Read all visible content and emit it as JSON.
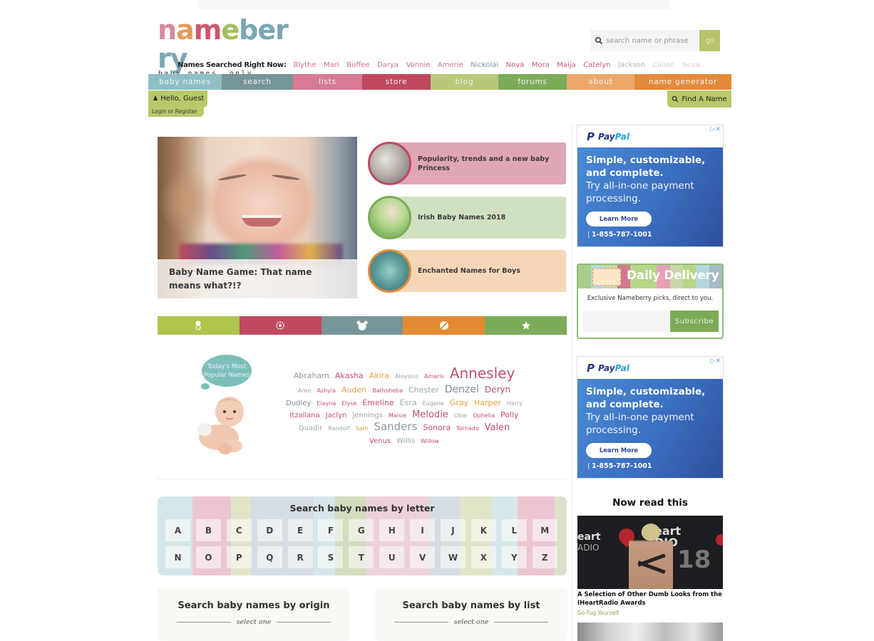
{
  "header": {
    "logo": {
      "letters": [
        "n",
        "a",
        "m",
        "e",
        "b",
        "e",
        "r",
        "r",
        "y"
      ],
      "letter_colors": [
        "#d98aa0",
        "#e39a5a",
        "#d0576e",
        "#9fc05c",
        "#7aa7b4",
        "#7aa7b4",
        "#7aa7b4",
        "#7aa7b4",
        "#7aa7b4"
      ],
      "tagline": "baby names, only cooler"
    },
    "search": {
      "placeholder": "search name or phrase",
      "go_label": "go"
    },
    "searched_now": {
      "label": "Names Searched Right Now:",
      "names": [
        {
          "name": "Blythe",
          "color": "#d0708c"
        },
        {
          "name": "Mari",
          "color": "#d0708c"
        },
        {
          "name": "Buffee",
          "color": "#d0708c"
        },
        {
          "name": "Darya",
          "color": "#d0708c"
        },
        {
          "name": "Vonnie",
          "color": "#d0708c"
        },
        {
          "name": "Amerie",
          "color": "#d0708c"
        },
        {
          "name": "Nickolai",
          "color": "#7a9aa2"
        },
        {
          "name": "Nova",
          "color": "#c85a78"
        },
        {
          "name": "Mora",
          "color": "#c85a78"
        },
        {
          "name": "Maija",
          "color": "#c85a78"
        },
        {
          "name": "Catelyn",
          "color": "#c85a78"
        },
        {
          "name": "Jackson",
          "color": "#a9b8bc"
        },
        {
          "name": "Cillian",
          "color": "#c6d2d6"
        },
        {
          "name": "Nova",
          "color": "#efc8d4"
        }
      ]
    }
  },
  "nav": {
    "items": [
      {
        "label": "baby names",
        "color": "#8fbfc5",
        "width": 103
      },
      {
        "label": "search",
        "color": "#779599",
        "width": 100
      },
      {
        "label": "lists",
        "color": "#d87a94",
        "width": 97
      },
      {
        "label": "store",
        "color": "#c04860",
        "width": 96
      },
      {
        "label": "blog",
        "color": "#b8c878",
        "width": 95
      },
      {
        "label": "forums",
        "color": "#7cab5a",
        "width": 96
      },
      {
        "label": "about",
        "color": "#eca868",
        "width": 95
      },
      {
        "label": "name generator",
        "color": "#e48a3a",
        "width": 136
      }
    ],
    "hello": "Hello, Guest",
    "login": "Login or Register",
    "find": "Find A Name"
  },
  "feature": {
    "caption": "Baby Name Game: That name means what?!?"
  },
  "feature_list": [
    {
      "text": "Popularity, trends and a new baby Princess",
      "bg": "#e0a6b4",
      "ring": "#c04860"
    },
    {
      "text": "Irish Baby Names 2018",
      "bg": "#cfe1c0",
      "ring": "#7cab5a"
    },
    {
      "text": "Enchanted Names for Boys",
      "bg": "#f5d7b8",
      "ring": "#e48a3a"
    }
  ],
  "category_bar": [
    {
      "icon": "pacifier-icon",
      "color": "#b0c44e"
    },
    {
      "icon": "flower-icon",
      "color": "#c04860"
    },
    {
      "icon": "bear-icon",
      "color": "#779599"
    },
    {
      "icon": "ball-icon",
      "color": "#e48a32"
    },
    {
      "icon": "star-icon",
      "color": "#7cab5a"
    }
  ],
  "popular": {
    "bubble": "Today's Most Popular Names",
    "lines": [
      [
        {
          "name": "Abraham",
          "size": 11,
          "color": "#8a9aa0"
        },
        {
          "name": "Akasha",
          "size": 11,
          "color": "#c8506e"
        },
        {
          "name": "Akira",
          "size": 11,
          "color": "#e8a040"
        },
        {
          "name": "Aloysius",
          "size": 8,
          "color": "#98a8ac"
        },
        {
          "name": "Amaris",
          "size": 8,
          "color": "#c8506e"
        },
        {
          "name": "Annesley",
          "size": 20,
          "color": "#c0506c"
        }
      ],
      [
        {
          "name": "Aren",
          "size": 8,
          "color": "#98a8ac"
        },
        {
          "name": "Ashyla",
          "size": 8,
          "color": "#c8506e"
        },
        {
          "name": "Auden",
          "size": 11,
          "color": "#e8a040"
        },
        {
          "name": "Bathsheba",
          "size": 8,
          "color": "#c8506e"
        },
        {
          "name": "Chester",
          "size": 11,
          "color": "#98a8ac"
        },
        {
          "name": "Denzel",
          "size": 14,
          "color": "#7a8e94"
        },
        {
          "name": "Deryn",
          "size": 12,
          "color": "#c0506c"
        }
      ],
      [
        {
          "name": "Dudley",
          "size": 10,
          "color": "#7a8e94"
        },
        {
          "name": "Elayna",
          "size": 8,
          "color": "#c8506e"
        },
        {
          "name": "Elyse",
          "size": 8,
          "color": "#c8506e"
        },
        {
          "name": "Emeline",
          "size": 11,
          "color": "#c8506e"
        },
        {
          "name": "Esra",
          "size": 11,
          "color": "#98a8ac"
        },
        {
          "name": "Eugene",
          "size": 8,
          "color": "#98a8ac"
        },
        {
          "name": "Gray",
          "size": 11,
          "color": "#e8a040"
        },
        {
          "name": "Harper",
          "size": 11,
          "color": "#e8a040"
        },
        {
          "name": "Harry",
          "size": 8,
          "color": "#98a8ac"
        }
      ],
      [
        {
          "name": "Itzallana",
          "size": 10,
          "color": "#c8506e"
        },
        {
          "name": "Jaclyn",
          "size": 10,
          "color": "#c8506e"
        },
        {
          "name": "Jennings",
          "size": 10,
          "color": "#98a8ac"
        },
        {
          "name": "Maisie",
          "size": 8,
          "color": "#c8506e"
        },
        {
          "name": "Melodie",
          "size": 13,
          "color": "#c0506c"
        },
        {
          "name": "Obie",
          "size": 8,
          "color": "#98a8ac"
        },
        {
          "name": "Ophelia",
          "size": 8,
          "color": "#c8506e"
        },
        {
          "name": "Polly",
          "size": 11,
          "color": "#c8506e"
        }
      ],
      [
        {
          "name": "Quadir",
          "size": 10,
          "color": "#98a8ac"
        },
        {
          "name": "Randolf",
          "size": 8,
          "color": "#98a8ac"
        },
        {
          "name": "Sam",
          "size": 8,
          "color": "#e8a040"
        },
        {
          "name": "Sanders",
          "size": 15,
          "color": "#8a9aa0"
        },
        {
          "name": "Sonora",
          "size": 11,
          "color": "#c8506e"
        },
        {
          "name": "Tornado",
          "size": 8,
          "color": "#c8506e"
        },
        {
          "name": "Valen",
          "size": 13,
          "color": "#c0506c"
        }
      ],
      [
        {
          "name": "Venus",
          "size": 10,
          "color": "#c8506e"
        },
        {
          "name": "Willis",
          "size": 10,
          "color": "#98a8ac"
        },
        {
          "name": "Willow",
          "size": 8,
          "color": "#c8506e"
        }
      ]
    ]
  },
  "letters": {
    "title": "Search baby names by letter",
    "items": [
      "A",
      "B",
      "C",
      "D",
      "E",
      "F",
      "G",
      "H",
      "I",
      "J",
      "K",
      "L",
      "M",
      "N",
      "O",
      "P",
      "Q",
      "R",
      "S",
      "T",
      "U",
      "V",
      "W",
      "X",
      "Y",
      "Z"
    ],
    "stripe_colors": [
      "#d6e7ea",
      "#ebc6d0",
      "#dfe6c6",
      "#d6dde2",
      "#d6dde2",
      "#d6e7ea",
      "#d3dcbd",
      "#ecd1dc",
      "#ecd1dc",
      "#d6dde2",
      "#dfe6c6",
      "#d6e7ea",
      "#ebc6d0",
      "#d9e2c8"
    ]
  },
  "search_cards": [
    {
      "title": "Search baby names by origin",
      "select": "select one"
    },
    {
      "title": "Search baby names by list",
      "select": "select one"
    }
  ],
  "sidebar": {
    "ads": [
      {
        "brand": "PayPal",
        "headline": "Simple, customizable, and complete.",
        "sub": "Try all-in-one payment processing.",
        "cta": "Learn More",
        "phone": "1-855-787-1001",
        "choices": "▷✕"
      },
      {
        "brand": "PayPal",
        "headline": "Simple, customizable, and complete.",
        "sub": "Try all-in-one payment processing.",
        "cta": "Learn More",
        "phone": "1-855-787-1001",
        "choices": "▷✕"
      }
    ],
    "daily": {
      "title": "Daily Delivery",
      "desc": "Exclusive Nameberry picks, direct to you.",
      "email_placeholder": "",
      "subscribe": "Subscribe",
      "stripe_colors": [
        "#a9cf8c",
        "#b6d7de",
        "#c9d6a8",
        "#d27890",
        "#b9d58a",
        "#b9d58a",
        "#e6a0b8",
        "#c9d6a8",
        "#b9d58a",
        "#b6d7de",
        "#a8b8c4"
      ]
    },
    "now_read": {
      "title": "Now read this",
      "caption": "A Selection of Other Dumb Looks from the IHeartRadio Awards",
      "source": "Go Fug Yourself",
      "img_text": {
        "a": "eart",
        "b": "ADIO",
        "c": "eart\nDIO",
        "d": "18"
      }
    }
  }
}
